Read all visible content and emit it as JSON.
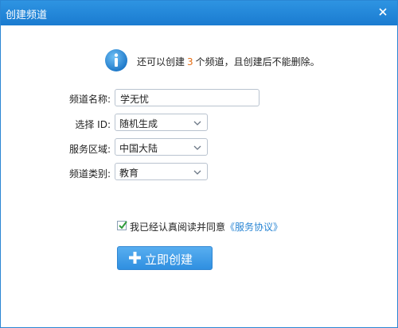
{
  "window": {
    "title": "创建频道"
  },
  "info": {
    "prefix": "还可以创建",
    "count": "3",
    "suffix": "个频道，且创建后不能删除。"
  },
  "form": {
    "name_label": "频道名称:",
    "name_value": "学无忧",
    "id_label": "选择 ID:",
    "id_value": "随机生成",
    "region_label": "服务区域:",
    "region_value": "中国大陆",
    "category_label": "频道类别:",
    "category_value": "教育"
  },
  "agreement": {
    "checked": true,
    "text": "我已经认真阅读并同意",
    "link": "《服务协议》"
  },
  "create_button": {
    "label": "立即创建"
  },
  "colors": {
    "accent": "#2a86d4",
    "highlight": "#e36c12"
  }
}
